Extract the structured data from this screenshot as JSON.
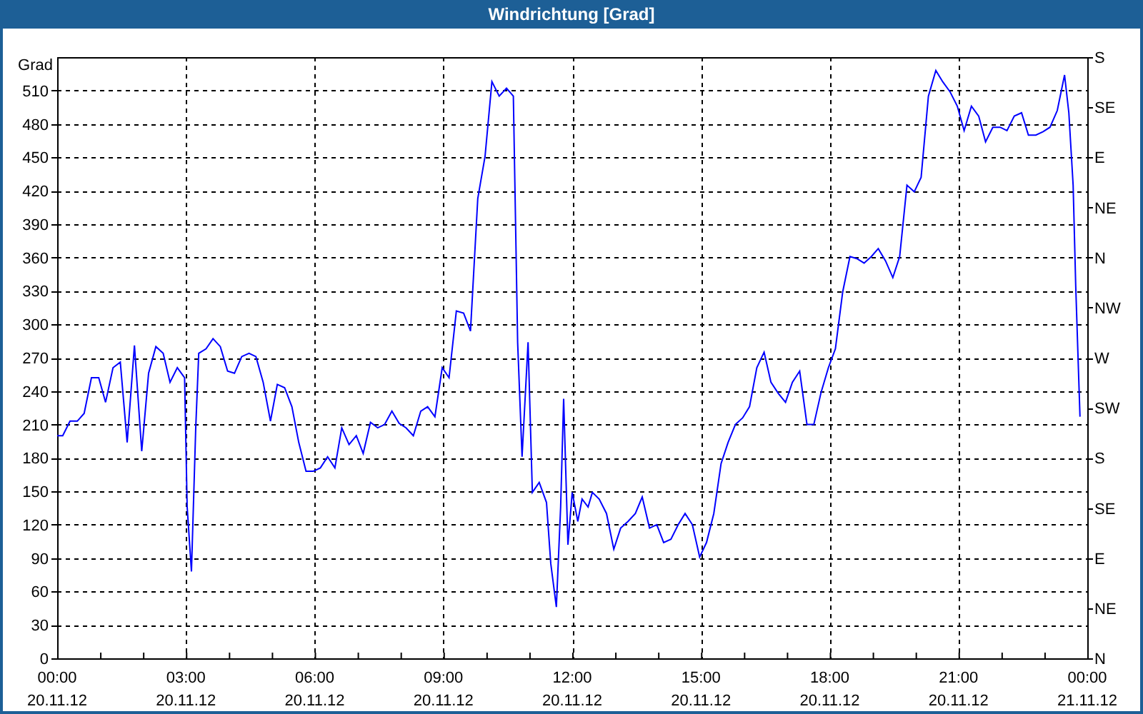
{
  "window": {
    "title": "Windrichtung [Grad]"
  },
  "chart": {
    "chart_data": {
      "type": "line",
      "grid": true,
      "ylabel": "Grad",
      "xlim": [
        0,
        24
      ],
      "ylim": [
        0,
        540
      ],
      "x": [
        0,
        0.13,
        0.3,
        0.47,
        0.63,
        0.8,
        0.97,
        1.13,
        1.3,
        1.47,
        1.63,
        1.8,
        1.97,
        2.13,
        2.3,
        2.47,
        2.63,
        2.8,
        2.97,
        3.03,
        3.13,
        3.23,
        3.3,
        3.47,
        3.63,
        3.8,
        3.97,
        4.13,
        4.3,
        4.47,
        4.63,
        4.8,
        4.97,
        5.13,
        5.3,
        5.47,
        5.63,
        5.8,
        5.97,
        6.13,
        6.3,
        6.47,
        6.63,
        6.8,
        6.97,
        7.13,
        7.3,
        7.47,
        7.63,
        7.8,
        7.97,
        8.13,
        8.3,
        8.47,
        8.63,
        8.8,
        8.97,
        9.13,
        9.3,
        9.47,
        9.63,
        9.8,
        9.97,
        10.13,
        10.3,
        10.47,
        10.63,
        10.73,
        10.83,
        10.97,
        11.07,
        11.23,
        11.4,
        11.5,
        11.63,
        11.73,
        11.8,
        11.9,
        12,
        12.13,
        12.23,
        12.37,
        12.47,
        12.63,
        12.8,
        12.97,
        13.13,
        13.3,
        13.47,
        13.63,
        13.8,
        13.97,
        14.13,
        14.3,
        14.47,
        14.63,
        14.8,
        14.97,
        15.13,
        15.3,
        15.47,
        15.63,
        15.8,
        15.97,
        16.13,
        16.3,
        16.47,
        16.63,
        16.8,
        16.97,
        17.13,
        17.3,
        17.47,
        17.63,
        17.8,
        17.97,
        18.13,
        18.3,
        18.47,
        18.63,
        18.8,
        18.97,
        19.13,
        19.3,
        19.47,
        19.63,
        19.8,
        19.97,
        20.13,
        20.3,
        20.47,
        20.63,
        20.8,
        20.97,
        21.13,
        21.3,
        21.47,
        21.63,
        21.8,
        21.97,
        22.13,
        22.3,
        22.47,
        22.63,
        22.8,
        22.97,
        23.13,
        23.3,
        23.47,
        23.57,
        23.67,
        23.73,
        23.8,
        23.83
      ],
      "series": [
        {
          "color": "#0000ff",
          "values": [
            200,
            200,
            213,
            213,
            220,
            252,
            252,
            230,
            261,
            266,
            194,
            281,
            186,
            256,
            280,
            274,
            248,
            261,
            252,
            136,
            78,
            207,
            274,
            278,
            287,
            280,
            258,
            256,
            271,
            274,
            271,
            248,
            213,
            246,
            243,
            226,
            194,
            168,
            168,
            171,
            181,
            171,
            207,
            192,
            200,
            184,
            212,
            207,
            210,
            222,
            211,
            207,
            200,
            222,
            226,
            217,
            261,
            252,
            312,
            310,
            294,
            413,
            451,
            518,
            505,
            512,
            505,
            284,
            181,
            284,
            149,
            158,
            140,
            85,
            46,
            136,
            233,
            102,
            149,
            123,
            143,
            136,
            149,
            143,
            130,
            98,
            117,
            123,
            130,
            145,
            117,
            120,
            104,
            107,
            120,
            130,
            120,
            91,
            104,
            130,
            175,
            194,
            210,
            216,
            226,
            261,
            275,
            248,
            238,
            230,
            248,
            258,
            210,
            210,
            239,
            261,
            278,
            329,
            361,
            359,
            355,
            361,
            368,
            357,
            342,
            361,
            425,
            419,
            432,
            505,
            528,
            518,
            509,
            496,
            474,
            496,
            487,
            464,
            477,
            477,
            474,
            487,
            490,
            470,
            470,
            473,
            477,
            492,
            524,
            490,
            425,
            335,
            252,
            217
          ]
        }
      ],
      "xticks": [
        {
          "value": 0,
          "label": "00:00"
        },
        {
          "value": 3,
          "label": "03:00"
        },
        {
          "value": 6,
          "label": "06:00"
        },
        {
          "value": 9,
          "label": "09:00"
        },
        {
          "value": 12,
          "label": "12:00"
        },
        {
          "value": 15,
          "label": "15:00"
        },
        {
          "value": 18,
          "label": "18:00"
        },
        {
          "value": 21,
          "label": "21:00"
        },
        {
          "value": 24,
          "label": "00:00"
        }
      ],
      "yticks": [
        0,
        30,
        60,
        90,
        120,
        150,
        180,
        210,
        240,
        270,
        300,
        330,
        360,
        390,
        420,
        450,
        480,
        510
      ]
    },
    "xtick_dates": [
      "20.11.12",
      "20.11.12",
      "20.11.12",
      "20.11.12",
      "20.11.12",
      "20.11.12",
      "20.11.12",
      "20.11.12",
      "21.11.12"
    ],
    "right_yticks": [
      "S",
      "SE",
      "E",
      "NE",
      "N",
      "NW",
      "W",
      "SW",
      "S",
      "SE",
      "E",
      "NE",
      "N"
    ]
  }
}
